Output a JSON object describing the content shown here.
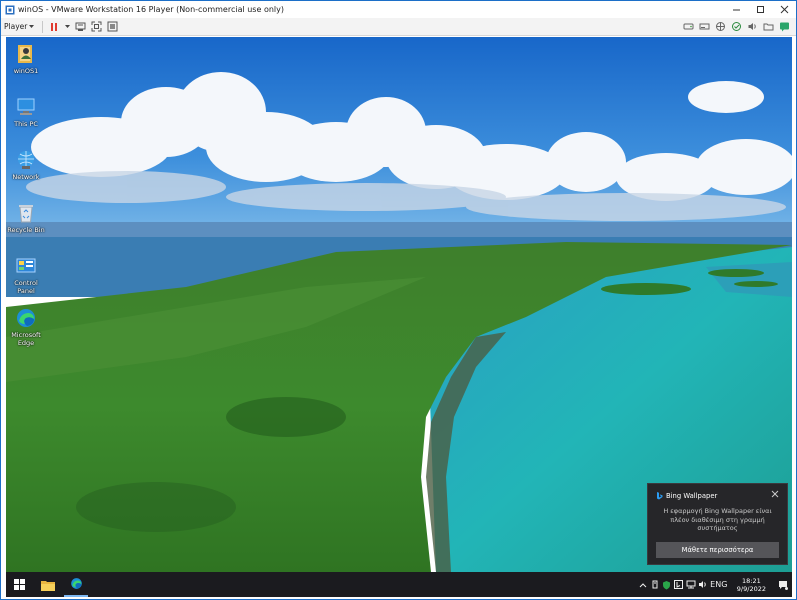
{
  "window": {
    "title": "winOS - VMware Workstation 16 Player (Non-commercial use only)",
    "player_menu": "Player"
  },
  "desktop": {
    "icons": [
      {
        "label": "winOS1",
        "icon": "user-folder-icon"
      },
      {
        "label": "This PC",
        "icon": "computer-icon"
      },
      {
        "label": "Network",
        "icon": "network-icon"
      },
      {
        "label": "Recycle Bin",
        "icon": "recycle-bin-icon"
      },
      {
        "label": "Control Panel",
        "icon": "control-panel-icon"
      },
      {
        "label": "Microsoft Edge",
        "icon": "edge-icon"
      }
    ]
  },
  "toast": {
    "app": "Bing Wallpaper",
    "message": "Η εφαρμογή Bing Wallpaper είναι πλέον διαθέσιμη στη γραμμή συστήματος",
    "button": "Μάθετε περισσότερα"
  },
  "taskbar": {
    "language": "ENG",
    "time": "18:21",
    "date": "9/9/2022"
  }
}
